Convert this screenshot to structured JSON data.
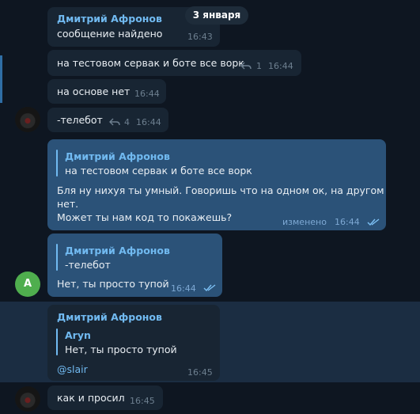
{
  "date_badge": "3 января",
  "messages": [
    {
      "sender": "Дмитрий Афронов",
      "text": "сообщение найдено",
      "time": "16:43"
    },
    {
      "text": "на тестовом сервак и боте все ворк",
      "replies": "1",
      "time": "16:44"
    },
    {
      "text": "на основе нет",
      "time": "16:44"
    },
    {
      "text": "-телебот",
      "replies": "4",
      "time": "16:44"
    },
    {
      "quote_name": "Дмитрий Афронов",
      "quote_text": "на тестовом сервак и боте все ворк",
      "line1": "Бля ну нихуя ты умный. Говоришь что на одном ок, на другом",
      "line2": "нет.",
      "line3": "Может ты нам код то покажешь?",
      "status": "изменено",
      "time": "16:44"
    },
    {
      "quote_name": "Дмитрий Афронов",
      "quote_text": "-телебот",
      "text": "Нет, ты просто тупой",
      "time": "16:44",
      "avatar_letter": "A"
    },
    {
      "sender": "Дмитрий Афронов",
      "quote_name": "Aryn",
      "quote_text": "Нет, ты просто тупой",
      "mention": "@slair",
      "time": "16:45"
    },
    {
      "text": "как и просил",
      "time": "16:45"
    }
  ],
  "colors": {
    "background": "#0e1621",
    "incoming_bubble": "#182533",
    "outgoing_bubble": "#2b5278",
    "accent": "#71baf1",
    "avatar_green": "#4fae4e",
    "highlight_row": "#1b2d42"
  }
}
